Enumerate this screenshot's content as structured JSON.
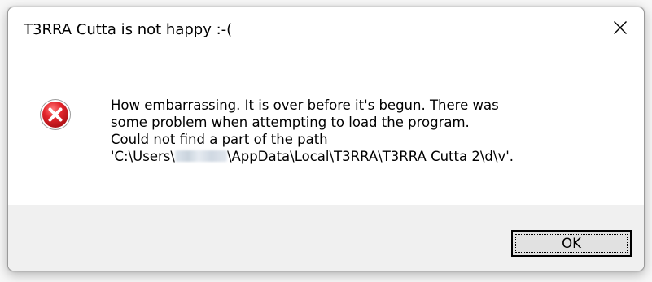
{
  "dialog": {
    "title": "T3RRA Cutta is not happy :-(",
    "close_icon": "close-icon",
    "icon": "error-icon",
    "message": {
      "line1": "How embarrassing. It is over before it's begun. There was",
      "line2": "some problem when attempting to load the program.",
      "line3": "Could not find a part of the path",
      "line4_prefix": "'C:\\Users\\",
      "line4_suffix": "\\AppData\\Local\\T3RRA\\T3RRA Cutta 2\\d\\v'."
    },
    "ok_label": "OK"
  },
  "colors": {
    "error_red": "#e81123",
    "footer_bg": "#f0f0f0",
    "button_bg": "#e1e1e1"
  }
}
